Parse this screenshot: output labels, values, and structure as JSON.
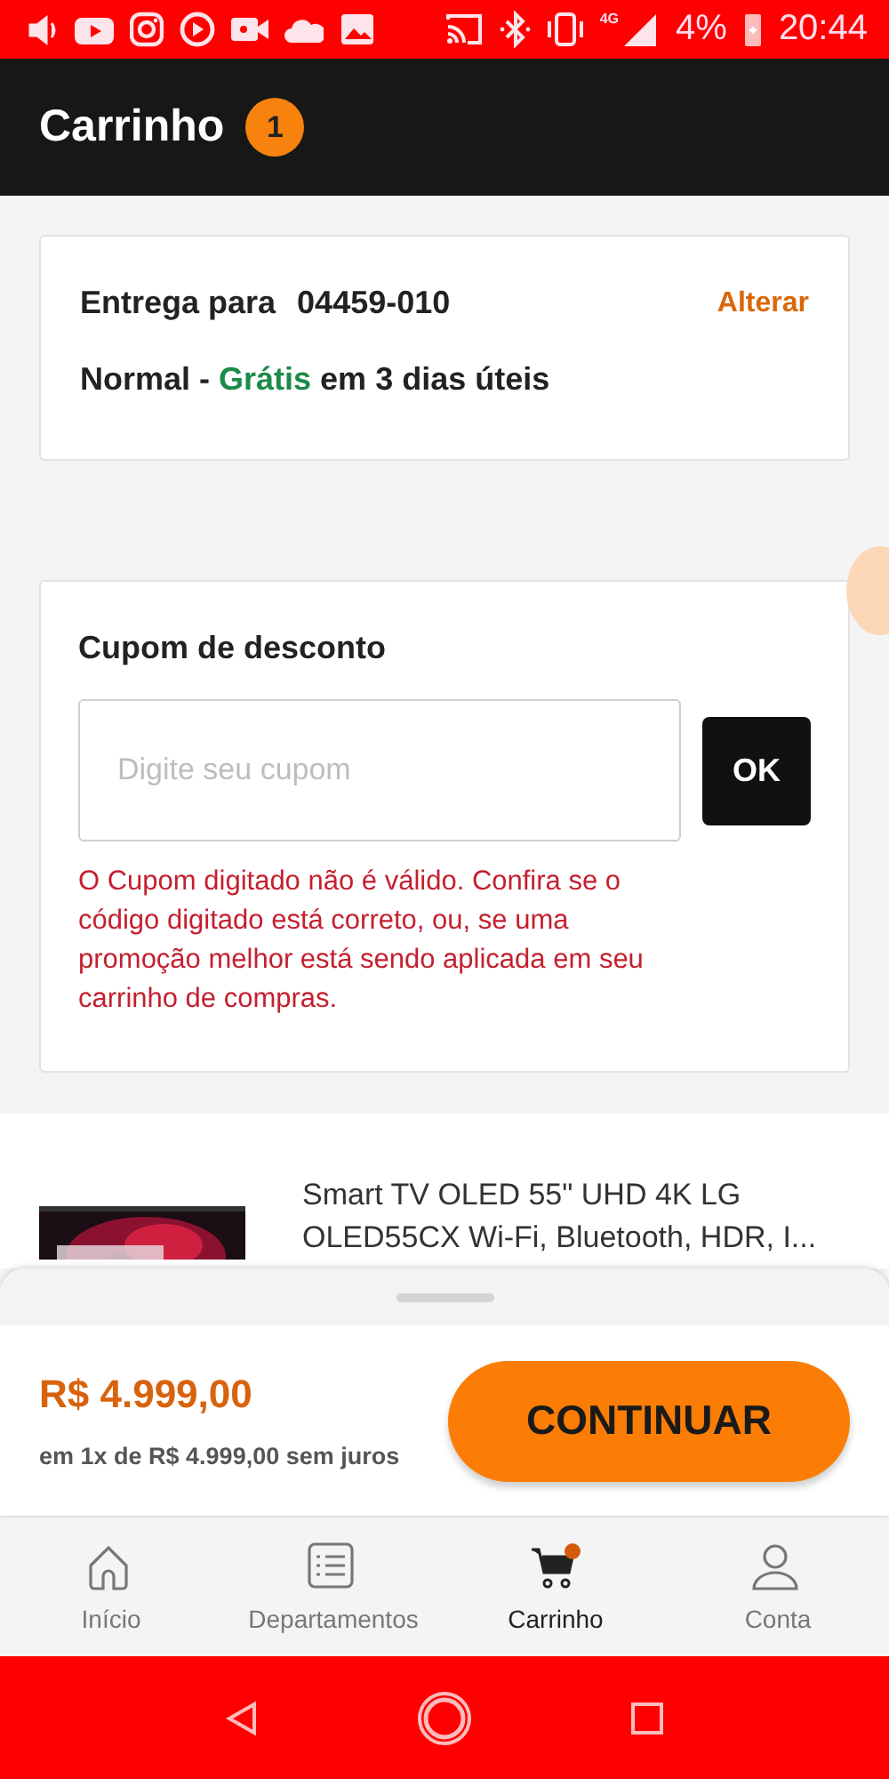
{
  "status_bar": {
    "network": "4G",
    "battery": "4%",
    "time": "20:44"
  },
  "header": {
    "title": "Carrinho",
    "badge": "1"
  },
  "delivery": {
    "label": "Entrega para",
    "zip": "04459-010",
    "action": "Alterar",
    "method": "Normal -",
    "price": "Grátis",
    "eta": "em 3 dias úteis"
  },
  "coupon": {
    "title": "Cupom de desconto",
    "placeholder": "Digite seu cupom",
    "button": "OK",
    "error": "O Cupom digitado não é válido. Confira se o código digitado está correto, ou, se uma promoção melhor está sendo aplicada em seu carrinho de compras."
  },
  "product": {
    "name": "Smart TV OLED 55\" UHD 4K LG OLED55CX Wi-Fi, Bluetooth, HDR, I..."
  },
  "summary": {
    "price": "R$ 4.999,00",
    "installments": "em 1x de R$ 4.999,00 sem juros",
    "button": "CONTINUAR"
  },
  "tab_bar": [
    {
      "label": "Início",
      "kind": "home",
      "selected": false,
      "badge": false
    },
    {
      "label": "Departamentos",
      "kind": "list",
      "selected": false,
      "badge": false
    },
    {
      "label": "Carrinho",
      "kind": "cart",
      "selected": true,
      "badge": true
    },
    {
      "label": "Conta",
      "kind": "user",
      "selected": false,
      "badge": false
    }
  ]
}
